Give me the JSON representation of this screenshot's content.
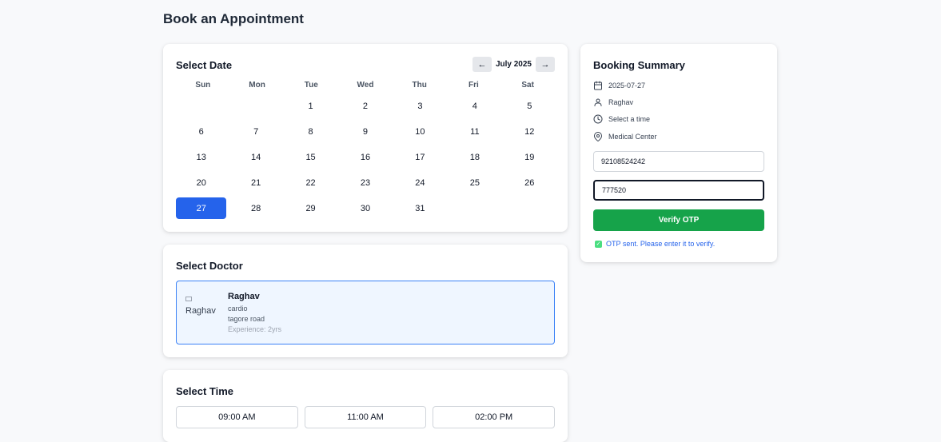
{
  "page": {
    "title": "Book an Appointment"
  },
  "calendar": {
    "title": "Select Date",
    "month_label": "July 2025",
    "prev_label": "←",
    "next_label": "→",
    "weekdays": [
      "Sun",
      "Mon",
      "Tue",
      "Wed",
      "Thu",
      "Fri",
      "Sat"
    ],
    "days": [
      "",
      "",
      "1",
      "2",
      "3",
      "4",
      "5",
      "6",
      "7",
      "8",
      "9",
      "10",
      "11",
      "12",
      "13",
      "14",
      "15",
      "16",
      "17",
      "18",
      "19",
      "20",
      "21",
      "22",
      "23",
      "24",
      "25",
      "26",
      "27",
      "28",
      "29",
      "30",
      "31"
    ],
    "selected_day": "27",
    "selected_color": "#2563eb"
  },
  "doctor": {
    "title": "Select Doctor",
    "options": [
      {
        "name": "Raghav",
        "image_alt": "Raghav",
        "specialty": "cardio",
        "location": "tagore road",
        "experience": "Experience: 2yrs"
      }
    ]
  },
  "time": {
    "title": "Select Time",
    "slots": [
      "09:00 AM",
      "11:00 AM",
      "02:00 PM"
    ]
  },
  "summary": {
    "title": "Booking Summary",
    "date": "2025-07-27",
    "doctor": "Raghav",
    "time": "Select a time",
    "location": "Medical Center",
    "phone_value": "92108524242",
    "otp_value": "777520",
    "verify_label": "Verify OTP",
    "verify_color": "#16a34a",
    "otp_status": "OTP sent. Please enter it to verify."
  },
  "icons": {
    "date": "calendar-icon",
    "doctor": "user-icon",
    "time": "clock-icon",
    "location": "map-pin-icon",
    "status": "check-icon"
  }
}
